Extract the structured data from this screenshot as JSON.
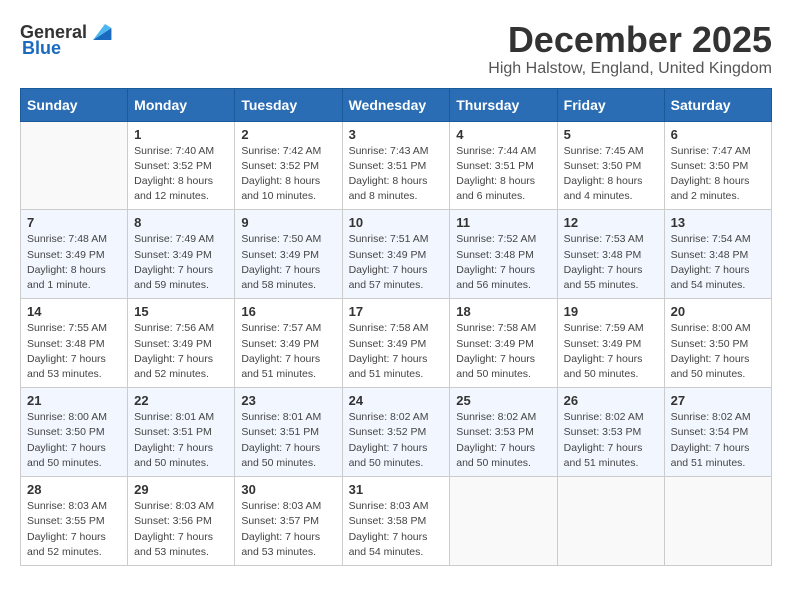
{
  "logo": {
    "text_general": "General",
    "text_blue": "Blue"
  },
  "title": "December 2025",
  "location": "High Halstow, England, United Kingdom",
  "days_of_week": [
    "Sunday",
    "Monday",
    "Tuesday",
    "Wednesday",
    "Thursday",
    "Friday",
    "Saturday"
  ],
  "weeks": [
    [
      {
        "day": "",
        "info": ""
      },
      {
        "day": "1",
        "info": "Sunrise: 7:40 AM\nSunset: 3:52 PM\nDaylight: 8 hours\nand 12 minutes."
      },
      {
        "day": "2",
        "info": "Sunrise: 7:42 AM\nSunset: 3:52 PM\nDaylight: 8 hours\nand 10 minutes."
      },
      {
        "day": "3",
        "info": "Sunrise: 7:43 AM\nSunset: 3:51 PM\nDaylight: 8 hours\nand 8 minutes."
      },
      {
        "day": "4",
        "info": "Sunrise: 7:44 AM\nSunset: 3:51 PM\nDaylight: 8 hours\nand 6 minutes."
      },
      {
        "day": "5",
        "info": "Sunrise: 7:45 AM\nSunset: 3:50 PM\nDaylight: 8 hours\nand 4 minutes."
      },
      {
        "day": "6",
        "info": "Sunrise: 7:47 AM\nSunset: 3:50 PM\nDaylight: 8 hours\nand 2 minutes."
      }
    ],
    [
      {
        "day": "7",
        "info": "Sunrise: 7:48 AM\nSunset: 3:49 PM\nDaylight: 8 hours\nand 1 minute."
      },
      {
        "day": "8",
        "info": "Sunrise: 7:49 AM\nSunset: 3:49 PM\nDaylight: 7 hours\nand 59 minutes."
      },
      {
        "day": "9",
        "info": "Sunrise: 7:50 AM\nSunset: 3:49 PM\nDaylight: 7 hours\nand 58 minutes."
      },
      {
        "day": "10",
        "info": "Sunrise: 7:51 AM\nSunset: 3:49 PM\nDaylight: 7 hours\nand 57 minutes."
      },
      {
        "day": "11",
        "info": "Sunrise: 7:52 AM\nSunset: 3:48 PM\nDaylight: 7 hours\nand 56 minutes."
      },
      {
        "day": "12",
        "info": "Sunrise: 7:53 AM\nSunset: 3:48 PM\nDaylight: 7 hours\nand 55 minutes."
      },
      {
        "day": "13",
        "info": "Sunrise: 7:54 AM\nSunset: 3:48 PM\nDaylight: 7 hours\nand 54 minutes."
      }
    ],
    [
      {
        "day": "14",
        "info": "Sunrise: 7:55 AM\nSunset: 3:48 PM\nDaylight: 7 hours\nand 53 minutes."
      },
      {
        "day": "15",
        "info": "Sunrise: 7:56 AM\nSunset: 3:49 PM\nDaylight: 7 hours\nand 52 minutes."
      },
      {
        "day": "16",
        "info": "Sunrise: 7:57 AM\nSunset: 3:49 PM\nDaylight: 7 hours\nand 51 minutes."
      },
      {
        "day": "17",
        "info": "Sunrise: 7:58 AM\nSunset: 3:49 PM\nDaylight: 7 hours\nand 51 minutes."
      },
      {
        "day": "18",
        "info": "Sunrise: 7:58 AM\nSunset: 3:49 PM\nDaylight: 7 hours\nand 50 minutes."
      },
      {
        "day": "19",
        "info": "Sunrise: 7:59 AM\nSunset: 3:49 PM\nDaylight: 7 hours\nand 50 minutes."
      },
      {
        "day": "20",
        "info": "Sunrise: 8:00 AM\nSunset: 3:50 PM\nDaylight: 7 hours\nand 50 minutes."
      }
    ],
    [
      {
        "day": "21",
        "info": "Sunrise: 8:00 AM\nSunset: 3:50 PM\nDaylight: 7 hours\nand 50 minutes."
      },
      {
        "day": "22",
        "info": "Sunrise: 8:01 AM\nSunset: 3:51 PM\nDaylight: 7 hours\nand 50 minutes."
      },
      {
        "day": "23",
        "info": "Sunrise: 8:01 AM\nSunset: 3:51 PM\nDaylight: 7 hours\nand 50 minutes."
      },
      {
        "day": "24",
        "info": "Sunrise: 8:02 AM\nSunset: 3:52 PM\nDaylight: 7 hours\nand 50 minutes."
      },
      {
        "day": "25",
        "info": "Sunrise: 8:02 AM\nSunset: 3:53 PM\nDaylight: 7 hours\nand 50 minutes."
      },
      {
        "day": "26",
        "info": "Sunrise: 8:02 AM\nSunset: 3:53 PM\nDaylight: 7 hours\nand 51 minutes."
      },
      {
        "day": "27",
        "info": "Sunrise: 8:02 AM\nSunset: 3:54 PM\nDaylight: 7 hours\nand 51 minutes."
      }
    ],
    [
      {
        "day": "28",
        "info": "Sunrise: 8:03 AM\nSunset: 3:55 PM\nDaylight: 7 hours\nand 52 minutes."
      },
      {
        "day": "29",
        "info": "Sunrise: 8:03 AM\nSunset: 3:56 PM\nDaylight: 7 hours\nand 53 minutes."
      },
      {
        "day": "30",
        "info": "Sunrise: 8:03 AM\nSunset: 3:57 PM\nDaylight: 7 hours\nand 53 minutes."
      },
      {
        "day": "31",
        "info": "Sunrise: 8:03 AM\nSunset: 3:58 PM\nDaylight: 7 hours\nand 54 minutes."
      },
      {
        "day": "",
        "info": ""
      },
      {
        "day": "",
        "info": ""
      },
      {
        "day": "",
        "info": ""
      }
    ]
  ]
}
